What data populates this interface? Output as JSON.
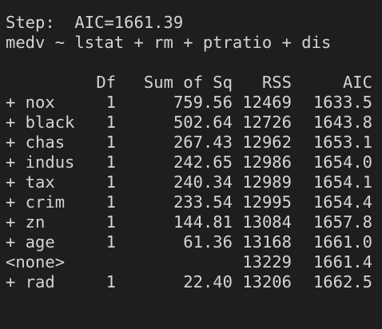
{
  "console": {
    "step_line": "Step:  AIC=1661.39",
    "formula_line": "medv ~ lstat + rm + ptratio + dis",
    "table": {
      "headers": {
        "term": "",
        "df": "Df",
        "ss": "Sum of Sq",
        "rss": "RSS",
        "aic": "AIC"
      },
      "rows": [
        {
          "term": "+ nox",
          "df": "1",
          "ss": "759.56",
          "rss": "12469",
          "aic": "1633.5"
        },
        {
          "term": "+ black",
          "df": "1",
          "ss": "502.64",
          "rss": "12726",
          "aic": "1643.8"
        },
        {
          "term": "+ chas",
          "df": "1",
          "ss": "267.43",
          "rss": "12962",
          "aic": "1653.1"
        },
        {
          "term": "+ indus",
          "df": "1",
          "ss": "242.65",
          "rss": "12986",
          "aic": "1654.0"
        },
        {
          "term": "+ tax",
          "df": "1",
          "ss": "240.34",
          "rss": "12989",
          "aic": "1654.1"
        },
        {
          "term": "+ crim",
          "df": "1",
          "ss": "233.54",
          "rss": "12995",
          "aic": "1654.4"
        },
        {
          "term": "+ zn",
          "df": "1",
          "ss": "144.81",
          "rss": "13084",
          "aic": "1657.8"
        },
        {
          "term": "+ age",
          "df": "1",
          "ss": "61.36",
          "rss": "13168",
          "aic": "1661.0"
        },
        {
          "term": "<none>",
          "df": "",
          "ss": "",
          "rss": "13229",
          "aic": "1661.4"
        },
        {
          "term": "+ rad",
          "df": "1",
          "ss": "22.40",
          "rss": "13206",
          "aic": "1662.5"
        }
      ]
    }
  }
}
